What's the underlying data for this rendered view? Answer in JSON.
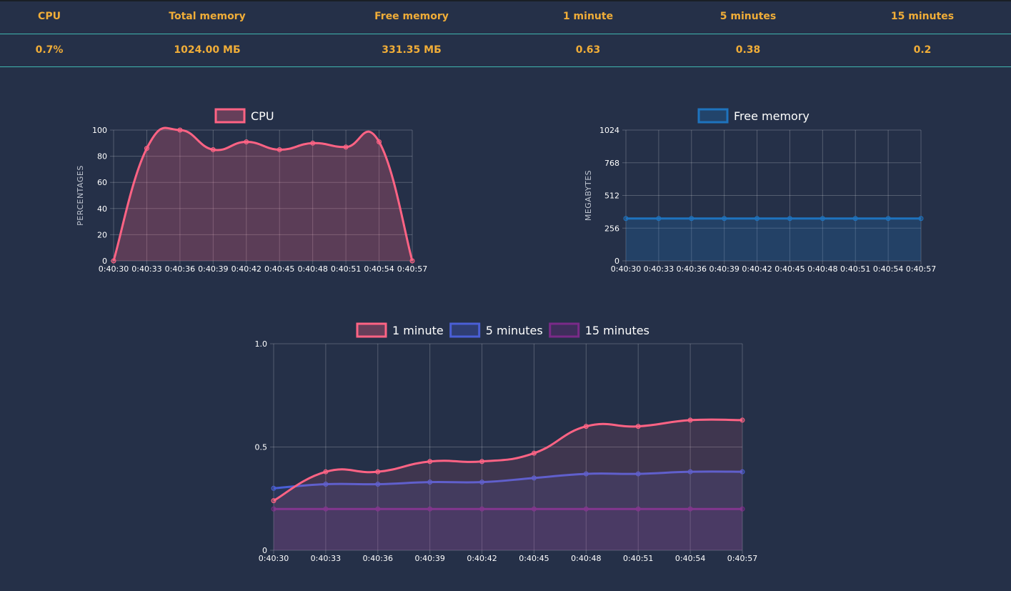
{
  "stats": {
    "headers": [
      "CPU",
      "Total memory",
      "Free memory",
      "1 minute",
      "5 minutes",
      "15 minutes"
    ],
    "values": [
      "0.7%",
      "1024.00 МБ",
      "331.35 МБ",
      "0.63",
      "0.38",
      "0.2"
    ],
    "color": "#f0ad38",
    "border_color": "#3fb5b0"
  },
  "chart_data": [
    {
      "type": "area",
      "x": [
        "0:40:30",
        "0:40:33",
        "0:40:36",
        "0:40:39",
        "0:40:42",
        "0:40:45",
        "0:40:48",
        "0:40:51",
        "0:40:54",
        "0:40:57"
      ],
      "series": [
        {
          "name": "CPU",
          "values": [
            0,
            86,
            100,
            85,
            91,
            85,
            90,
            87,
            91,
            0
          ],
          "color": "#ff6384"
        }
      ],
      "ylabel": "PERCENTAGES",
      "ylim": [
        0,
        100
      ],
      "yticks": [
        "0",
        "20",
        "40",
        "60",
        "80",
        "100"
      ],
      "grid": true,
      "legend": "top"
    },
    {
      "type": "area",
      "x": [
        "0:40:30",
        "0:40:33",
        "0:40:36",
        "0:40:39",
        "0:40:42",
        "0:40:45",
        "0:40:48",
        "0:40:51",
        "0:40:54",
        "0:40:57"
      ],
      "series": [
        {
          "name": "Free memory",
          "values": [
            331.35,
            331.35,
            331.35,
            331.35,
            331.35,
            331.35,
            331.35,
            331.35,
            331.35,
            331.35
          ],
          "color": "#1e73be"
        }
      ],
      "ylabel": "MEGABYTES",
      "ylim": [
        0,
        1024
      ],
      "yticks": [
        "0",
        "256",
        "512",
        "768",
        "1024"
      ],
      "grid": true,
      "legend": "top"
    },
    {
      "type": "area",
      "x": [
        "0:40:30",
        "0:40:33",
        "0:40:36",
        "0:40:39",
        "0:40:42",
        "0:40:45",
        "0:40:48",
        "0:40:51",
        "0:40:54",
        "0:40:57"
      ],
      "series": [
        {
          "name": "1 minute",
          "values": [
            0.24,
            0.38,
            0.38,
            0.43,
            0.43,
            0.47,
            0.6,
            0.6,
            0.63,
            0.63
          ],
          "color": "#ff6384"
        },
        {
          "name": "5 minutes",
          "values": [
            0.3,
            0.32,
            0.32,
            0.33,
            0.33,
            0.35,
            0.37,
            0.37,
            0.38,
            0.38
          ],
          "color": "#4a5fd6"
        },
        {
          "name": "15 minutes",
          "values": [
            0.2,
            0.2,
            0.2,
            0.2,
            0.2,
            0.2,
            0.2,
            0.2,
            0.2,
            0.2
          ],
          "color": "#7a2a88"
        }
      ],
      "ylabel": "",
      "ylim": [
        0,
        1
      ],
      "yticks": [
        "0",
        "0.5",
        "1.0"
      ],
      "grid": true,
      "legend": "top"
    }
  ]
}
